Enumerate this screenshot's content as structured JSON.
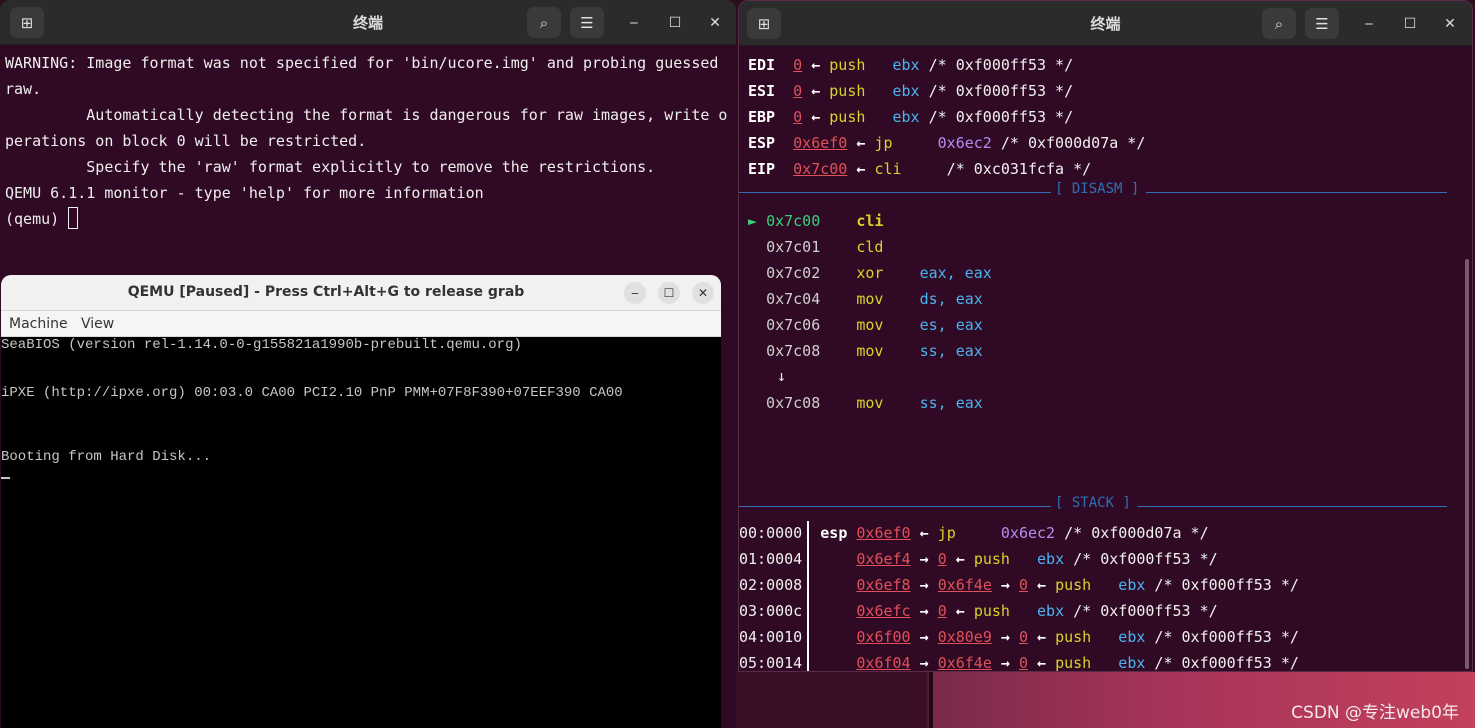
{
  "left_terminal": {
    "title": "终端",
    "lines": [
      "WARNING: Image format was not specified for 'bin/ucore.img' and probing guessed",
      "raw.",
      "         Automatically detecting the format is dangerous for raw images, write o",
      "perations on block 0 will be restricted.",
      "         Specify the 'raw' format explicitly to remove the restrictions.",
      "QEMU 6.1.1 monitor - type 'help' for more information"
    ],
    "prompt": "(qemu) "
  },
  "right_terminal": {
    "title": "终端",
    "registers": [
      {
        "name": "EDI",
        "val": "0",
        "arrow": "←",
        "ins": "push",
        "op": "   ebx",
        "comment": " /* 0xf000ff53 */",
        "op_color": "blu"
      },
      {
        "name": "ESI",
        "val": "0",
        "arrow": "←",
        "ins": "push",
        "op": "   ebx",
        "comment": " /* 0xf000ff53 */",
        "op_color": "blu"
      },
      {
        "name": "EBP",
        "val": "0",
        "arrow": "←",
        "ins": "push",
        "op": "   ebx",
        "comment": " /* 0xf000ff53 */",
        "op_color": "blu"
      },
      {
        "name": "ESP",
        "val": "0x6ef0",
        "arrow": "←",
        "ins": "jp",
        "op": "     0x6ec2",
        "comment": " /* 0xf000d07a */",
        "op_color": "pur"
      },
      {
        "name": "EIP",
        "val": "0x7c00",
        "arrow": "←",
        "ins": "cli",
        "op": "",
        "comment": "     /* 0xc031fcfa */",
        "op_color": "blu"
      }
    ],
    "disasm_label": "[ DISASM ]",
    "disasm": [
      {
        "marker": "►",
        "addr": "0x7c00",
        "ins": "cli",
        "ops": "",
        "current": true
      },
      {
        "marker": " ",
        "addr": "0x7c01",
        "ins": "cld",
        "ops": "",
        "current": false
      },
      {
        "marker": " ",
        "addr": "0x7c02",
        "ins": "xor",
        "ops": "eax, eax",
        "current": false
      },
      {
        "marker": " ",
        "addr": "0x7c04",
        "ins": "mov",
        "ops": "ds, eax",
        "current": false
      },
      {
        "marker": " ",
        "addr": "0x7c06",
        "ins": "mov",
        "ops": "es, eax",
        "current": false
      },
      {
        "marker": " ",
        "addr": "0x7c08",
        "ins": "mov",
        "ops": "ss, eax",
        "current": false
      }
    ],
    "down_arrow": "↓",
    "disasm_tail": {
      "addr": "0x7c08",
      "ins": "mov",
      "ops": "ss, eax"
    },
    "stack_label": "[ STACK ]",
    "stack": [
      {
        "off": "00:0000",
        "reg": "esp",
        "a1": "0x6ef0",
        "a2": "",
        "a3": "",
        "ins": "jp",
        "op": "     0x6ec2",
        "comment": " /* 0xf000d07a */",
        "op_color": "pur",
        "arrow": "←"
      },
      {
        "off": "01:0004",
        "reg": "",
        "a1": "0x6ef4",
        "a2": "0",
        "a3": "",
        "ins": "push",
        "op": "   ebx",
        "comment": " /* 0xf000ff53 */",
        "op_color": "blu",
        "arrow": "←"
      },
      {
        "off": "02:0008",
        "reg": "",
        "a1": "0x6ef8",
        "a2": "0x6f4e",
        "a3": "0",
        "ins": "push",
        "op": "   ebx",
        "comment": " /* 0xf000ff53 */",
        "op_color": "blu",
        "arrow": "←"
      },
      {
        "off": "03:000c",
        "reg": "",
        "a1": "0x6efc",
        "a2": "0",
        "a3": "",
        "ins": "push",
        "op": "   ebx",
        "comment": " /* 0xf000ff53 */",
        "op_color": "blu",
        "arrow": "←"
      },
      {
        "off": "04:0010",
        "reg": "",
        "a1": "0x6f00",
        "a2": "0x80e9",
        "a3": "0",
        "ins": "push",
        "op": "   ebx",
        "comment": " /* 0xf000ff53 */",
        "op_color": "blu",
        "arrow": "←"
      },
      {
        "off": "05:0014",
        "reg": "",
        "a1": "0x6f04",
        "a2": "0x6f4e",
        "a3": "0",
        "ins": "push",
        "op": "   ebx",
        "comment": " /* 0xf000ff53 */",
        "op_color": "blu",
        "arrow": "←"
      }
    ]
  },
  "qemu_window": {
    "title": "QEMU [Paused] - Press Ctrl+Alt+G to release grab",
    "menu": [
      "Machine",
      "View"
    ],
    "screen_lines": [
      "SeaBIOS (version rel-1.14.0-0-g155821a1990b-prebuilt.qemu.org)",
      "",
      "iPXE (http://ipxe.org) 00:03.0 CA00 PCI2.10 PnP PMM+07F8F390+07EEF390 CA00",
      "",
      "",
      "Booting from Hard Disk..."
    ]
  },
  "watermark": "CSDN @专注web0年"
}
